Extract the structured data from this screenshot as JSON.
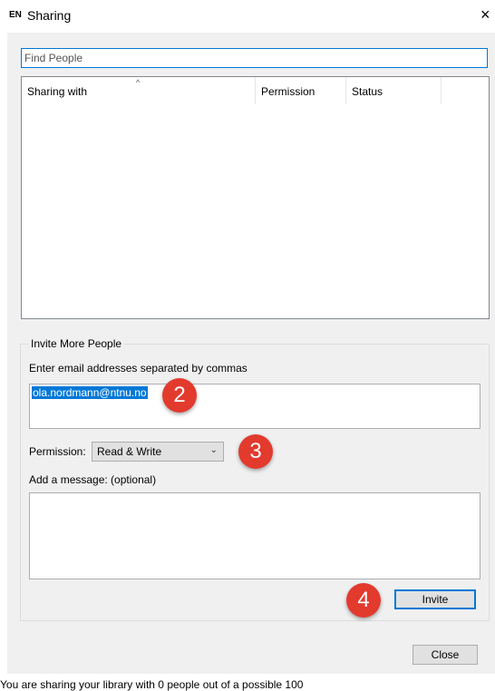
{
  "window": {
    "icon_text": "EN",
    "title": "Sharing",
    "close_glyph": "×"
  },
  "find": {
    "placeholder": "Find People"
  },
  "table": {
    "columns": [
      "Sharing with",
      "Permission",
      "Status",
      ""
    ],
    "sort_indicator": "^"
  },
  "invite": {
    "group_title": "Invite More People",
    "email_label": "Enter email addresses separated by commas",
    "email_value": "ola.nordmann@ntnu.no",
    "permission_label": "Permission:",
    "permission_value": "Read & Write",
    "message_label": "Add a message: (optional)",
    "invite_button": "Invite"
  },
  "footer": {
    "close_button": "Close",
    "status_text": "You are sharing your library with 0 people out of a possible 100"
  },
  "badges": [
    "2",
    "3",
    "4"
  ],
  "colors": {
    "accent": "#0078d7",
    "badge": "#e33a2e",
    "dialog_bg": "#f0f0f0"
  }
}
